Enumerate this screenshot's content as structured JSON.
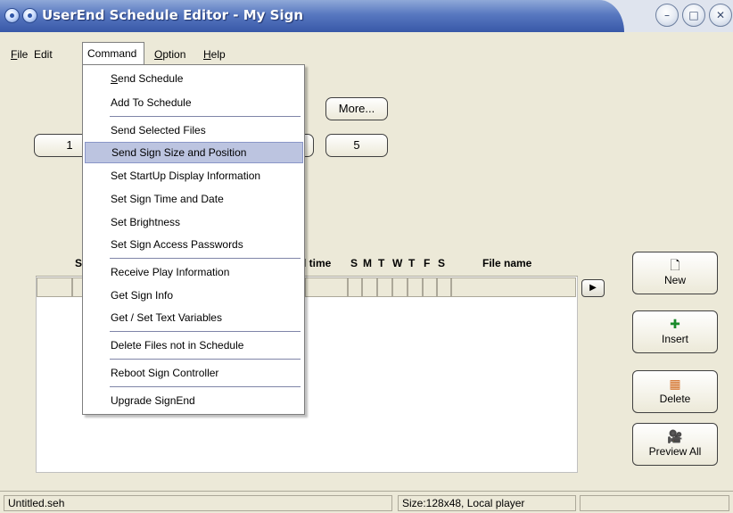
{
  "window": {
    "title": "UserEnd Schedule Editor - My Sign",
    "controls": [
      "minimize-icon",
      "maximize-icon",
      "close-icon"
    ]
  },
  "menubar": {
    "items": [
      {
        "label": "File",
        "mnemonic": "F"
      },
      {
        "label": "Edit"
      },
      {
        "label": "Command",
        "open": true
      },
      {
        "label": "Option",
        "mnemonic": "O"
      },
      {
        "label": "Help",
        "mnemonic": "H"
      }
    ]
  },
  "dropdown": {
    "items": [
      {
        "label": "Send Schedule",
        "mnemonic": "S"
      },
      {
        "label": "Add To Schedule"
      },
      {
        "label": "Send Selected Files"
      },
      {
        "label": "Send Sign Size and Position",
        "selected": true
      },
      {
        "label": "Set StartUp Display Information"
      },
      {
        "label": "Set Sign Time and Date"
      },
      {
        "label": "Set Brightness"
      },
      {
        "label": "Set Sign Access Passwords"
      },
      {
        "label": "Receive Play Information"
      },
      {
        "label": "Get Sign Info"
      },
      {
        "label": "Get / Set Text Variables"
      },
      {
        "label": "Delete Files not in Schedule"
      },
      {
        "label": "Reboot Sign Controller"
      },
      {
        "label": "Upgrade SignEnd"
      }
    ]
  },
  "pages": {
    "more_label": "More...",
    "page_1": "1",
    "page_5": "5"
  },
  "grid": {
    "columns": [
      "S",
      "l time",
      "S",
      "M",
      "T",
      "W",
      "T",
      "F",
      "S",
      "File name"
    ]
  },
  "side_buttons": [
    {
      "label": "New",
      "icon": "new-document-icon"
    },
    {
      "label": "Insert",
      "icon": "insert-icon"
    },
    {
      "label": "Delete",
      "icon": "delete-icon"
    },
    {
      "label": "Preview All",
      "icon": "preview-icon"
    }
  ],
  "status": {
    "file": "Untitled.seh",
    "info": "Size:128x48, Local player"
  },
  "colors": {
    "titlebar_blue": "#3858a8",
    "selection": "#bcc4e0",
    "window_bg": "#ece9d8"
  }
}
